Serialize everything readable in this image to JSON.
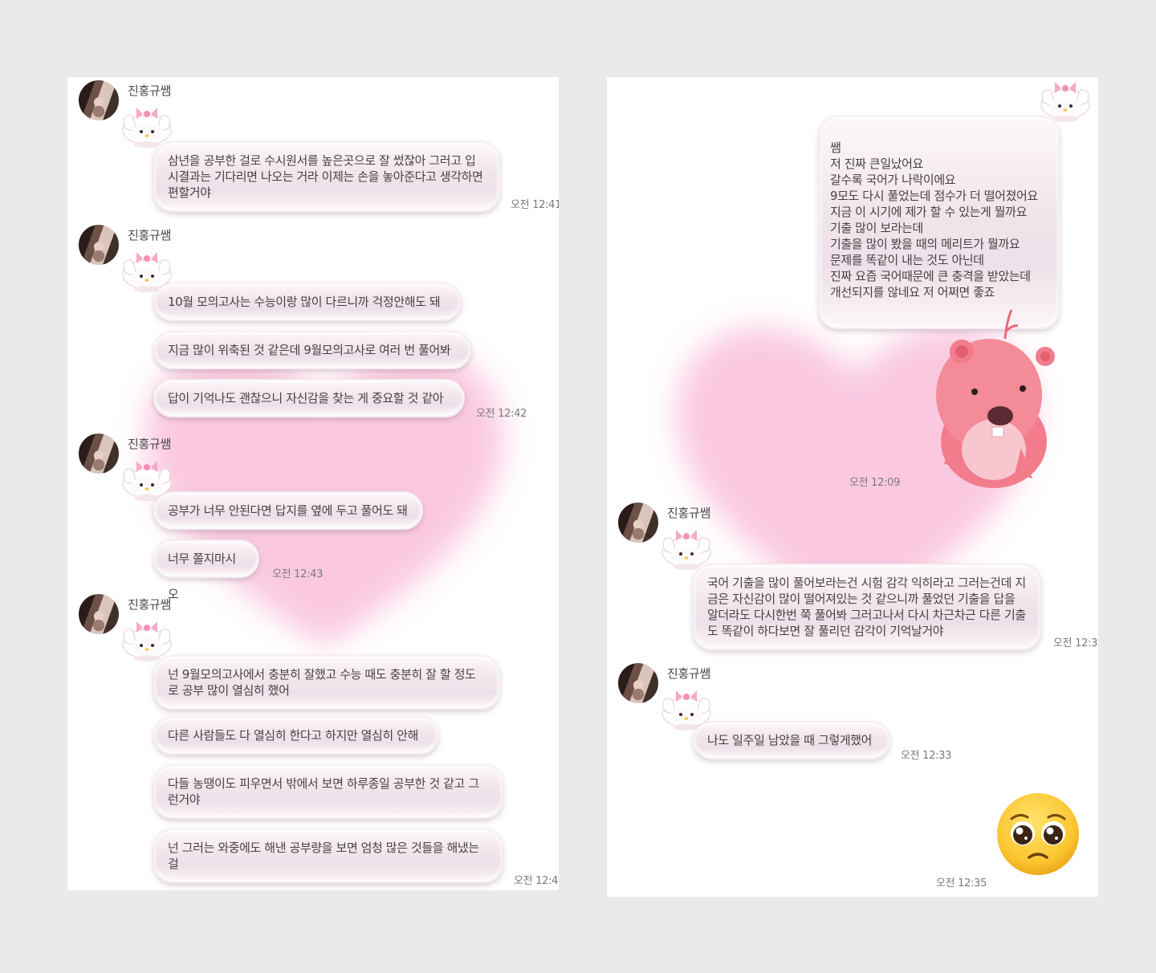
{
  "colors": {
    "background": "#e9eaeb",
    "panel": "#ffffff",
    "heart": "#f7b7d6",
    "bubble": "#f1e5ec"
  },
  "left": {
    "groups": [
      {
        "sender": "진홍규쌤",
        "avatar_icon": "profile-photo",
        "messages": [
          "삼년을 공부한 걸로 수시원서를 높은곳으로 잘 썼잖아 그러고 입시결과는 기다리면 나오는 거라 이제는 손을 놓아준다고 생각하면 편할거야"
        ],
        "time": "오전 12:41"
      },
      {
        "sender": "진홍규쌤",
        "messages": [
          "10월 모의고사는 수능이랑 많이 다르니까 걱정안해도 돼",
          "지금 많이 위축된 것 같은데 9월모의고사로 여러 번 풀어봐",
          "답이 기억나도 괜찮으니 자신감을 찾는 게 중요할 것 같아"
        ],
        "time": "오전 12:42"
      },
      {
        "sender": "진홍규쌤",
        "messages": [
          "공부가 너무 안된다면 답지를 옆에 두고 풀어도 돼",
          "너무 쫄지마시오"
        ],
        "time": "오전 12:43"
      },
      {
        "sender": "진홍규쌤",
        "messages": [
          "넌 9월모의고사에서 충분히 잘했고 수능 때도 충분히 잘 할 정도로 공부 많이 열심히 했어",
          "다른 사람들도 다 열심히 한다고 하지만 열심히 안해",
          "다들 농땡이도 피우면서 밖에서 보면 하루종일 공부한 것 같고 그런거야",
          "넌 그러는 와중에도 해낸 공부량을 보면 엄청 많은 것들을 해냈는 걸"
        ],
        "time": "오전 12:4"
      }
    ]
  },
  "right": {
    "my_message": "쌤\n저 진짜 큰일났어요\n갈수록 국어가 나락이에요\n9모도 다시 풀었는데 점수가 더 떨어졌어요\n지금 이 시기에 제가 할 수 있는게 뭘까요\n기출 많이 보라는데\n기출을 많이 봤을 때의 메리트가 뭘까요\n문제를 똑같이 내는 것도 아닌데\n진짜 요즘 국어때문에 큰 충격을 받았는데\n개선되지를 않네요 저 어쩌면 좋죠",
    "sticker_icon": "loopy-beaver-sticker",
    "sticker_time": "오전 12:09",
    "groups": [
      {
        "sender": "진홍규쌤",
        "messages": [
          "국어 기출을 많이 풀어보라는건 시험 감각 익히라고 그러는건데 지금은 자신감이 많이 떨어져있는 것 같으니까 풀었던 기출을 답을 알더라도 다시한번 쭉 풀어봐 그러고나서 다시 차근차근 다른 기출도 똑같이 하다보면 잘 풀리던 감각이 기억날거야"
        ],
        "time": "오전 12:3"
      },
      {
        "sender": "진홍규쌤",
        "messages": [
          "나도 일주일 남았을 때 그렇게했어"
        ],
        "time": "오전 12:33"
      }
    ],
    "emoji_icon": "pleading-face-emoji",
    "emoji_time": "오전 12:35"
  }
}
